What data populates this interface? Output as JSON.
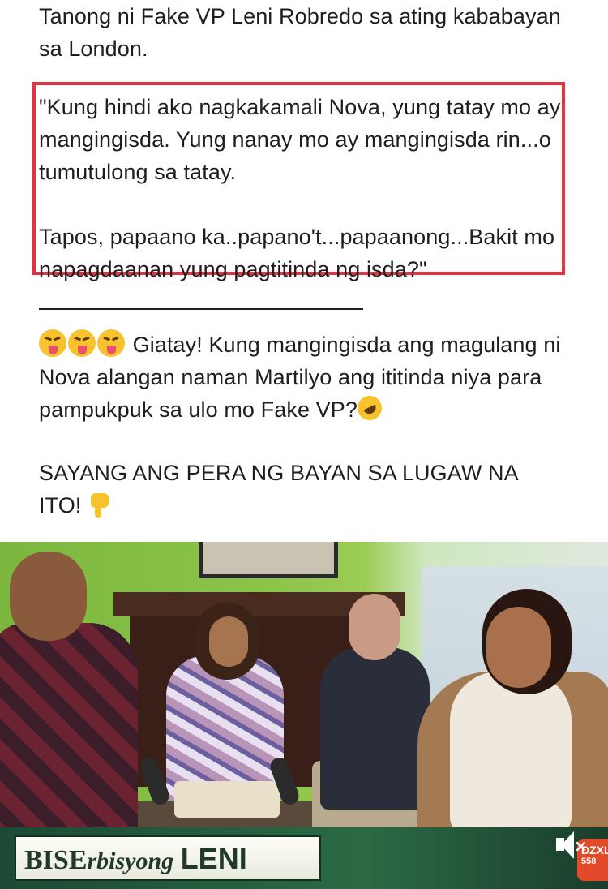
{
  "post": {
    "intro": "Tanong ni Fake VP Leni Robredo sa ating kababayan sa London.",
    "quote_line1": "\"Kung hindi ako nagkakamali Nova, yung tatay mo ay mangingisda. Yung nanay mo ay mangingisda rin...o tumutulong sa tatay.",
    "quote_line2": "Tapos, papaano ka..papano't...papaanong...Bakit mo napagdaanan yung pagtitinda ng isda?\"",
    "divider": "———————————————-",
    "reaction": "Giatay! Kung mangingisda ang magulang ni Nova alangan naman Martilyo ang ititinda niya para pampukpuk sa ulo mo Fake VP?",
    "shout": "SAYANG ANG PERA NG BAYAN SA LUGAW NA ITO!",
    "emoji_reaction": "squinting-tongue-face",
    "emoji_laugh": "rolling-on-floor-laughing",
    "emoji_thumb": "thumbs-down"
  },
  "video": {
    "banner_prefix": "BISE",
    "banner_middle": "rbisyong",
    "banner_name": "LENI",
    "station": "DZXL",
    "station_number": "558",
    "mute_icon": "speaker-muted-icon"
  },
  "colors": {
    "highlight_border": "#e53243",
    "banner_bg": "#2b6a45",
    "text": "#1c1e21"
  }
}
